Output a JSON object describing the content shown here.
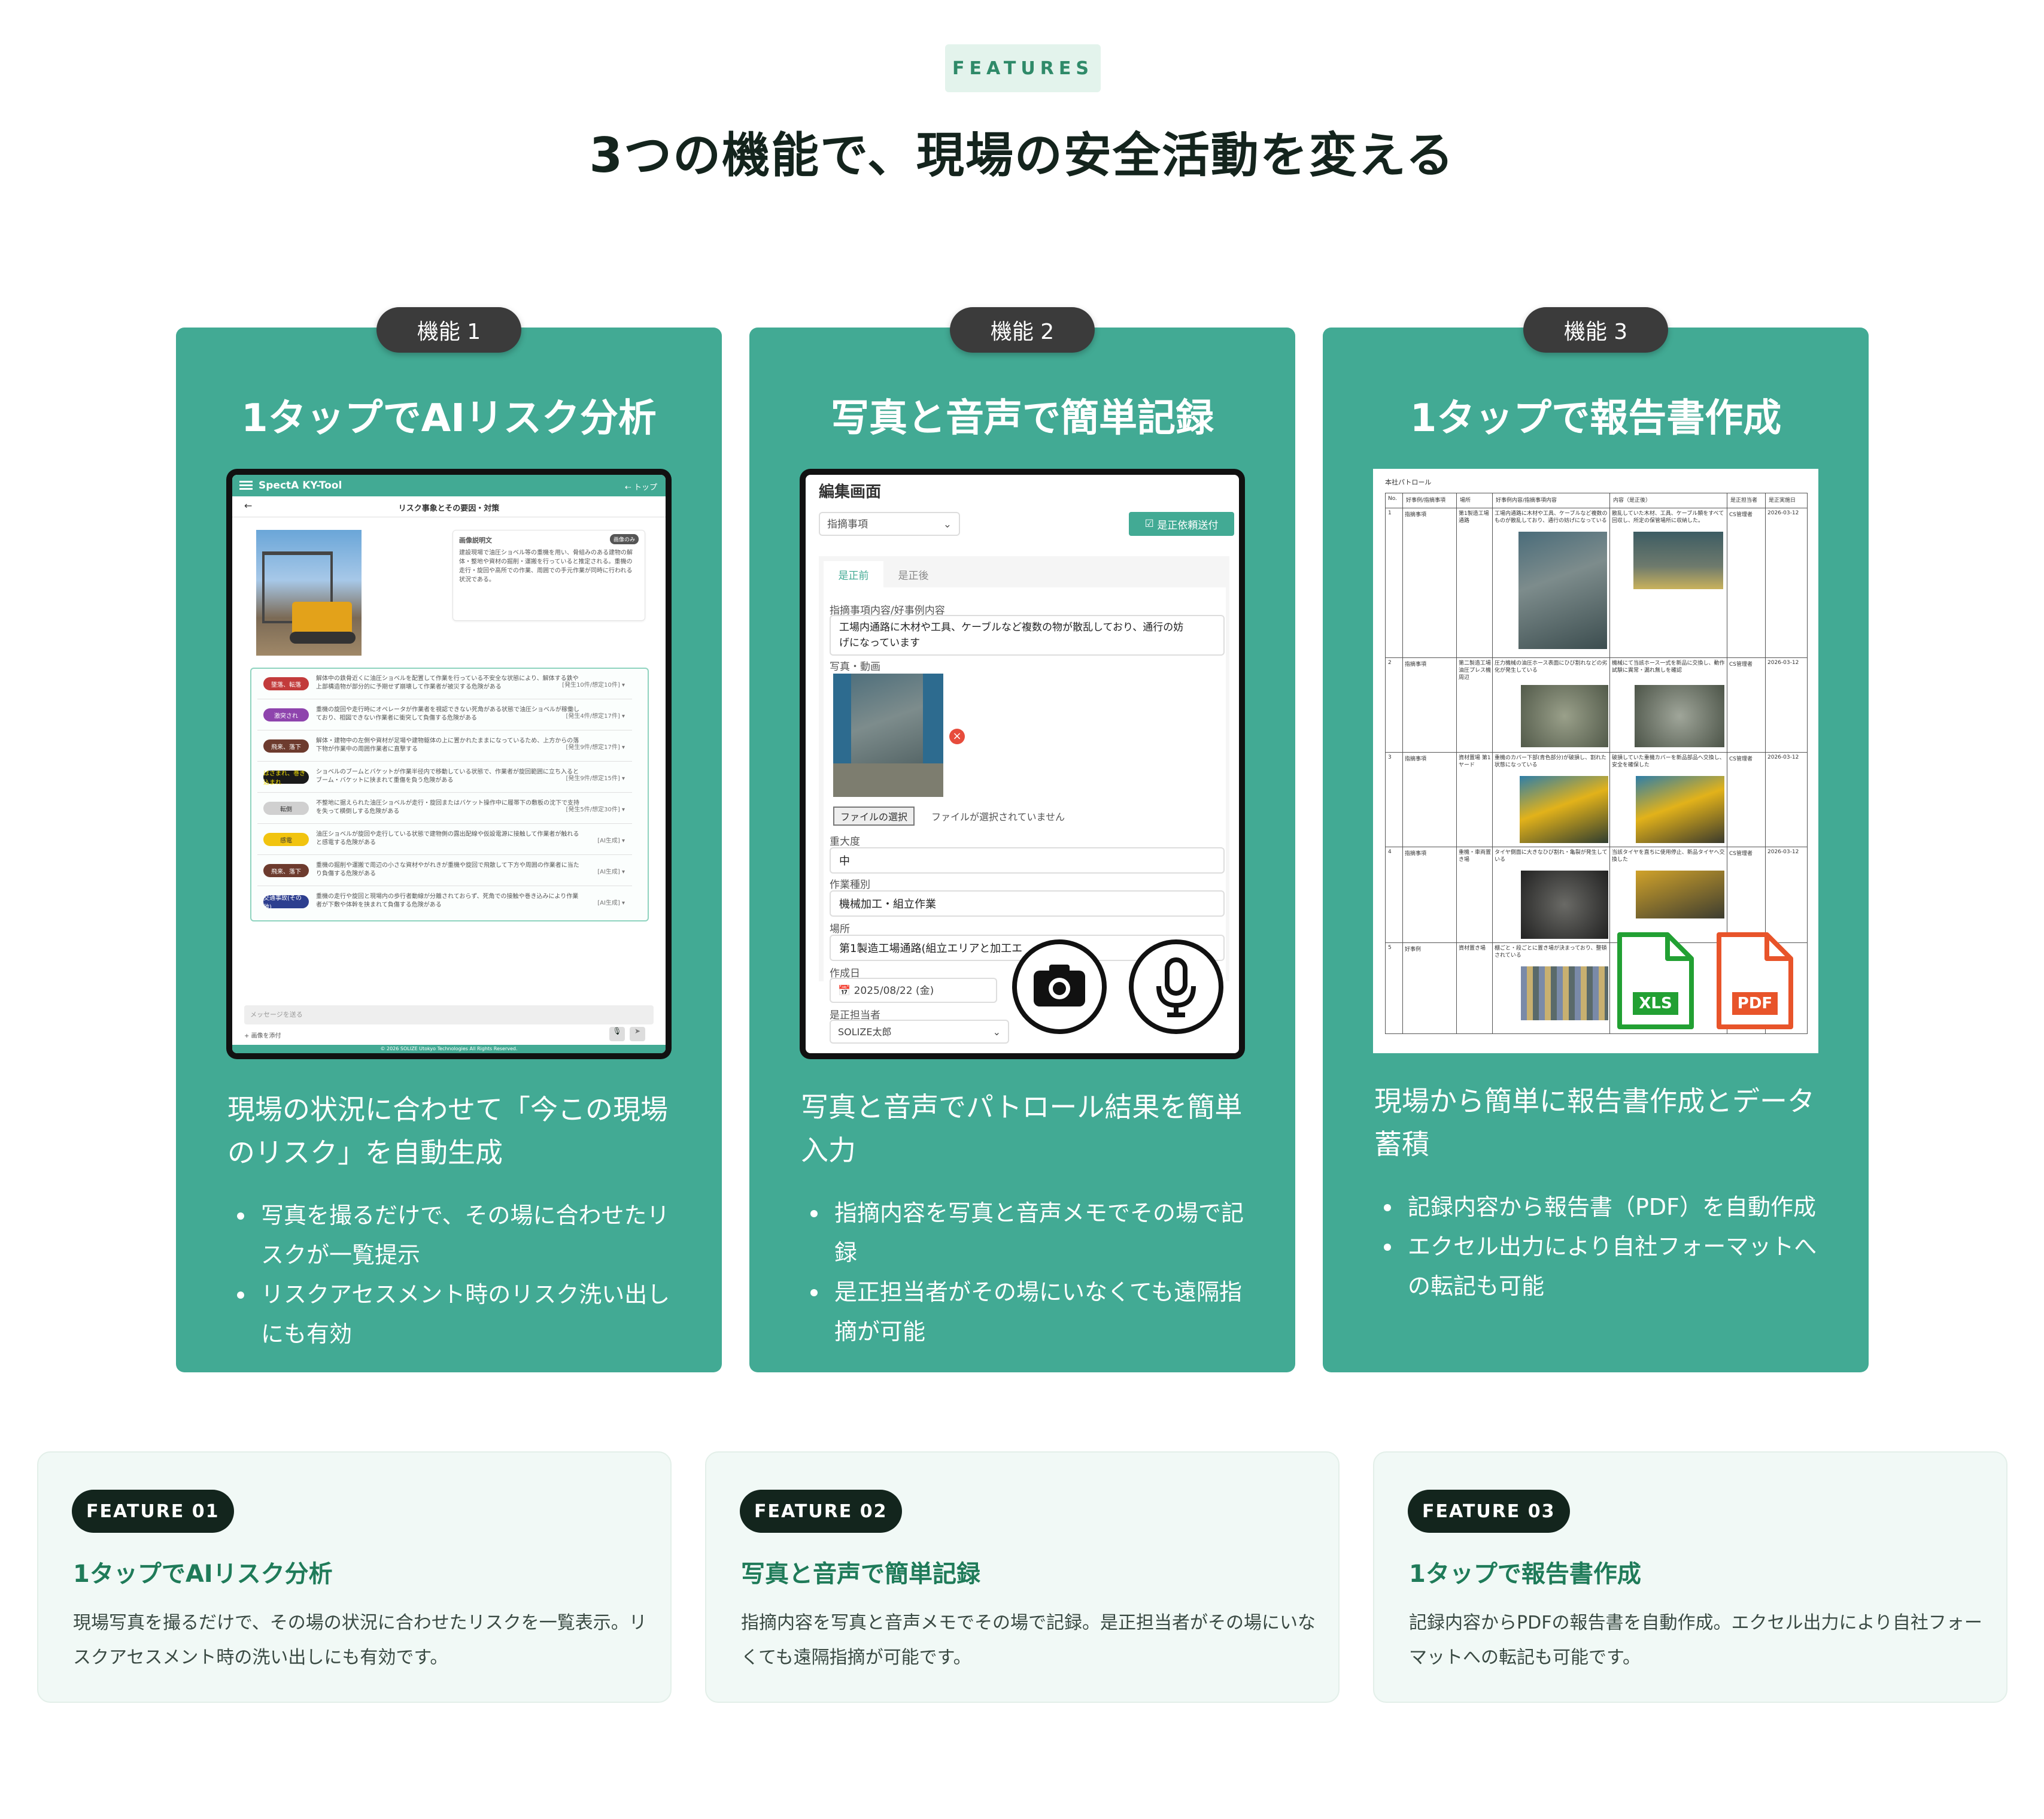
{
  "section": {
    "eyebrow": "FEATURES",
    "headline": "3つの機能で、現場の安全活動を変える"
  },
  "colors": {
    "card_green": "#42aa94",
    "pill_dark": "#3b3b3b",
    "badge_dark": "#13251d",
    "accent_green": "#1f7b59",
    "xls_green": "#22a033",
    "pdf_orange": "#e8542a"
  },
  "cards": [
    {
      "pill": "機能 1",
      "title": "1タップでAIリスク分析",
      "lead": "現場の状況に合わせて「今この現場のリスク」を自動生成",
      "bullets": [
        "写真を撮るだけで、その場に合わせたリスクが一覧提示",
        "リスクアセスメント時のリスク洗い出しにも有効"
      ],
      "mock": {
        "app_name": "SpectA KY-Tool",
        "top_link": "トップ",
        "page_title": "リスク事象とその要因・対策",
        "desc_label": "画像説明文",
        "desc_badge": "画像のみ",
        "desc_text": "建設現場で油圧ショベル等の重機を用い、骨組みのある建物の解体・整地や資材の掘削・運搬を行っていると推定される。重機の走行・旋回や高所での作業、周囲での手元作業が同時に行われる状況である。",
        "risks": [
          {
            "tag": "墜落、転落",
            "text": "解体中の鉄骨近くに油圧ショベルを配置して作業を行っている不安全な状態により、解体する鉄や上部構造物が部分的に予期せず崩壊して作業者が被災する危険がある",
            "meta": "[発生10件/想定10件]",
            "color": "#c23b3b"
          },
          {
            "tag": "激突され",
            "text": "重機の旋回や走行時にオペレータが作業者を視認できない死角がある状態で油圧ショベルが稼働しており、相図できない作業者に衝突して負傷する危険がある",
            "meta": "[発生4件/想定17件]",
            "color": "#8e44ad"
          },
          {
            "tag": "飛来、落下",
            "text": "解体・建物中の左側や資材が足場や建物躯体の上に置かれたままになっているため、上方からの落下物が作業中の周囲作業者に直撃する",
            "meta": "[発生9件/想定17件]",
            "color": "#6d3b2e"
          },
          {
            "tag": "はさまれ、巻き込まれ",
            "text": "ショベルのブームとバケットが作業半径内で移動している状態で、作業者が旋回範囲に立ち入るとブーム・バケットに挟まれて重傷を負う危険がある",
            "meta": "[発生9件/想定15件]",
            "color": "#1a1a1a"
          },
          {
            "tag": "転倒",
            "text": "不整地に据えられた油圧ショベルが走行・旋回またはバケット操作中に履帯下の敷板の沈下で支持を失って横倒しする危険がある",
            "meta": "[発生5件/想定30件]",
            "color": "#d0d0d0"
          },
          {
            "tag": "感電",
            "text": "油圧ショベルが旋回や走行している状態で建物側の露出配線や仮設電源に接触して作業者が触れると感電する危険がある",
            "meta": "[AI生成]",
            "color": "#f1c40f"
          },
          {
            "tag": "飛来、落下",
            "text": "重機の掘削や運搬で周辺の小さな資材やがれきが重機や旋回で飛散して下方や周囲の作業者に当たり負傷する危険がある",
            "meta": "[AI生成]",
            "color": "#6d3b2e"
          },
          {
            "tag": "交通事故(その他)",
            "text": "重機の走行や旋回と現場内の歩行者動線が分離されておらず、死角での接触や巻き込みにより作業者が下敷や体幹を挟まれて負傷する危険がある",
            "meta": "[AI生成]",
            "color": "#2c3e8f"
          }
        ],
        "message_placeholder": "メッセージを送る",
        "attach_label": "画像を添付",
        "footer": "© 2026 SOLIZE Utokyo Technologies All Rights Reserved."
      }
    },
    {
      "pill": "機能 2",
      "title": "写真と音声で簡単記録",
      "lead": "写真と音声でパトロール結果を簡単入力",
      "bullets": [
        "指摘内容を写真と音声メモでその場で記録",
        "是正担当者がその場にいなくても遠隔指摘が可能"
      ],
      "mock": {
        "screen_title": "編集画面",
        "select_value": "指摘事項",
        "send_button": "是正依頼送付",
        "tab_before": "是正前",
        "tab_after": "是正後",
        "content_label": "指摘事項内容/好事例内容",
        "content_value": "工場内通路に木材や工具、ケーブルなど複数の物が散乱しており、通行の妨げになっています",
        "photo_label": "写真・動画",
        "file_button": "ファイルの選択",
        "file_status": "ファイルが選択されていません",
        "severity_label": "重大度",
        "severity_value": "中",
        "work_type_label": "作業種別",
        "work_type_value": "機械加工・組立作業",
        "place_label": "場所",
        "place_value": "第1製造工場通路(組立エリアと加工エ",
        "date_label": "作成日",
        "date_value": "2025/08/22 (金)",
        "assignee_label": "是正担当者",
        "assignee_value": "SOLIZE太郎"
      }
    },
    {
      "pill": "機能 3",
      "title": "1タップで報告書作成",
      "lead": "現場から簡単に報告書作成とデータ蓄積",
      "bullets": [
        "記録内容から報告書（PDF）を自動作成",
        "エクセル出力により自社フォーマットへの転記も可能"
      ],
      "mock": {
        "report_title": "本社パトロール",
        "headers": [
          "No.",
          "好事例/指摘事項",
          "場所",
          "好事例内容/指摘事項内容",
          "写真",
          "内容（是正後）",
          "写真",
          "是正担当者",
          "是正実施日"
        ],
        "rows": [
          {
            "no": "1",
            "type": "指摘事項",
            "place": "第1製造工場通路",
            "content": "工場内通路に木材や工具、ケーブルなど複数のものが散乱しており、通行の妨げになっている",
            "after": "散乱していた木材、工具、ケーブル類をすべて回収し、所定の保管場所に収納した。",
            "person": "CS管理者",
            "date": "2026-03-12"
          },
          {
            "no": "2",
            "type": "指摘事項",
            "place": "第二製造工場 油圧プレス機周辺",
            "content": "圧力機械の油圧ホース表面にひび割れなどの劣化が発生している",
            "after": "機械にて当該ホース一式を新品に交換し、動作試験に異常・漏れ無しを確認",
            "person": "CS管理者",
            "date": "2026-03-12"
          },
          {
            "no": "3",
            "type": "指摘事項",
            "place": "資材置場 第1ヤード",
            "content": "重機のカバー下部(青色部分)が破損し、割れた状態になっている",
            "after": "破損していた重機カバーを新品部品へ交換し、安全を確保した",
            "person": "CS管理者",
            "date": "2026-03-12"
          },
          {
            "no": "4",
            "type": "指摘事項",
            "place": "重機・車両置き場",
            "content": "タイヤ側面に大きなひび割れ・亀裂が発生している",
            "after": "当該タイヤを直ちに使用停止、新品タイヤへ交換した",
            "person": "CS管理者",
            "date": "2026-03-12"
          },
          {
            "no": "5",
            "type": "好事例",
            "place": "資材置き場",
            "content": "棚ごと・段ごとに置き場が決まっており、整頓されている",
            "after": "",
            "person": "",
            "date": ""
          }
        ],
        "xls_label": "XLS",
        "pdf_label": "PDF"
      }
    }
  ],
  "features": [
    {
      "badge": "FEATURE 01",
      "title": "1タップでAIリスク分析",
      "desc": "現場写真を撮るだけで、その場の状況に合わせたリスクを一覧表示。リスクアセスメント時の洗い出しにも有効です。"
    },
    {
      "badge": "FEATURE 02",
      "title": "写真と音声で簡単記録",
      "desc": "指摘内容を写真と音声メモでその場で記録。是正担当者がその場にいなくても遠隔指摘が可能です。"
    },
    {
      "badge": "FEATURE 03",
      "title": "1タップで報告書作成",
      "desc": "記録内容からPDFの報告書を自動作成。エクセル出力により自社フォーマットへの転記も可能です。"
    }
  ]
}
